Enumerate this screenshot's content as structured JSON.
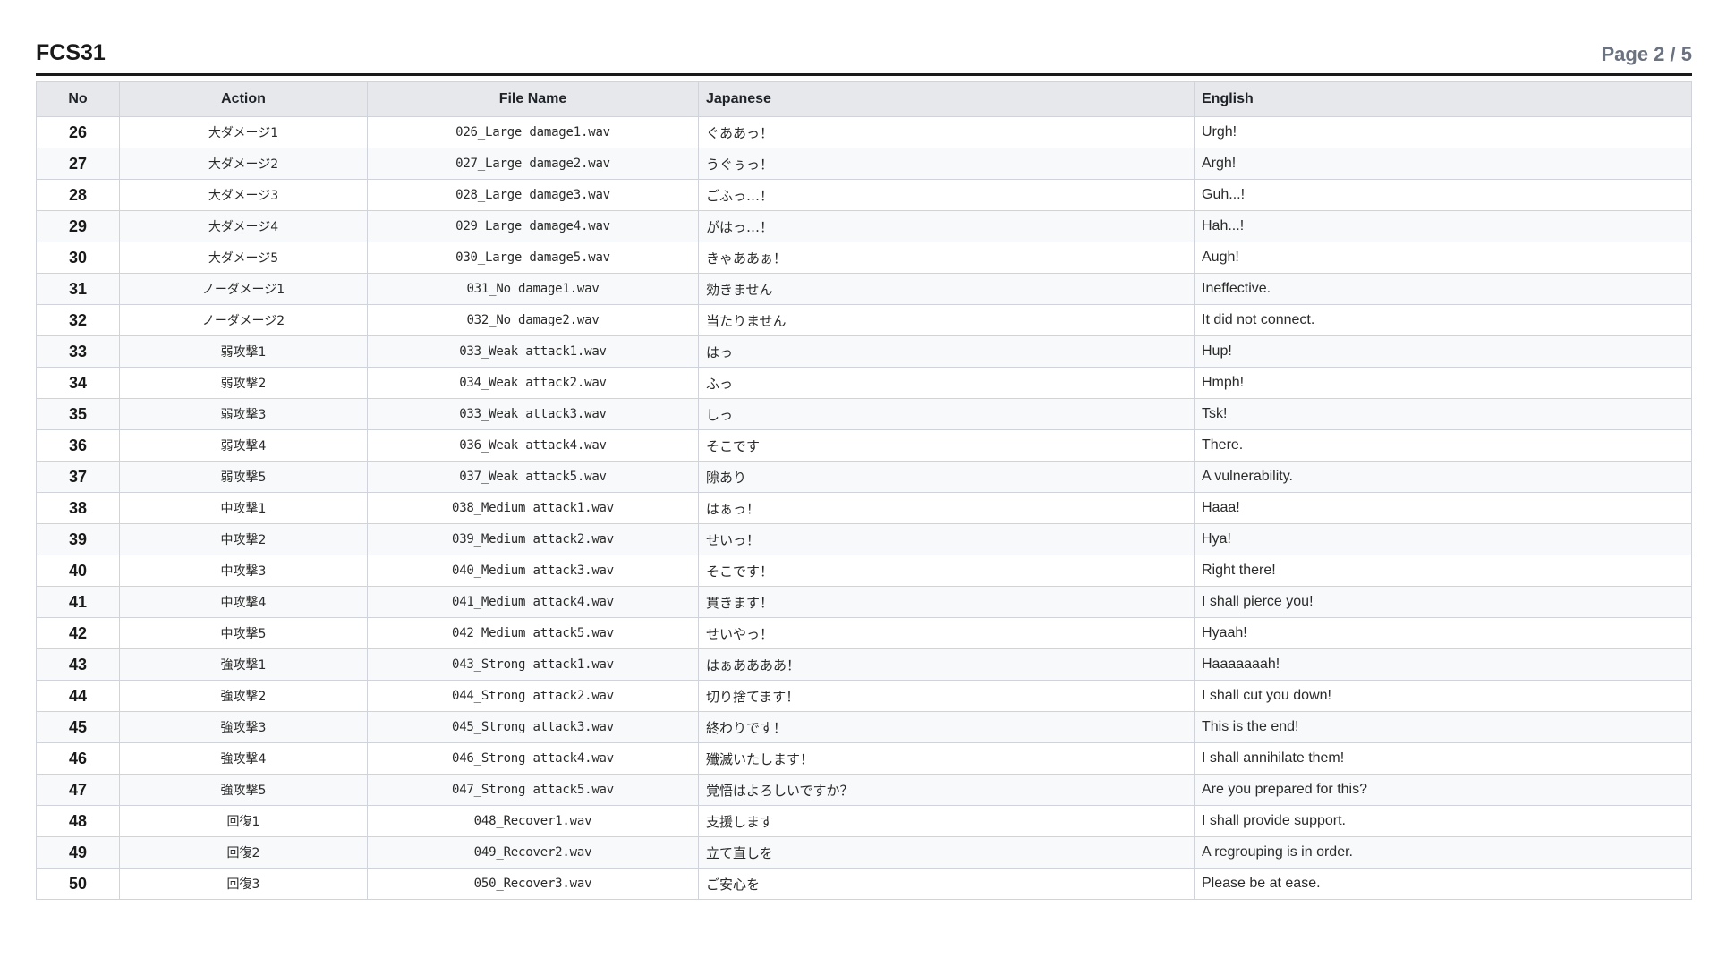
{
  "header": {
    "title": "FCS31",
    "page_indicator": "Page 2 / 5"
  },
  "table": {
    "columns": [
      "No",
      "Action",
      "File Name",
      "Japanese",
      "English"
    ],
    "rows": [
      {
        "no": "26",
        "action": "大ダメージ1",
        "file": "026_Large damage1.wav",
        "ja": "ぐああっ！",
        "en": "Urgh!"
      },
      {
        "no": "27",
        "action": "大ダメージ2",
        "file": "027_Large damage2.wav",
        "ja": "うぐぅっ！",
        "en": "Argh!"
      },
      {
        "no": "28",
        "action": "大ダメージ3",
        "file": "028_Large damage3.wav",
        "ja": "ごふっ…！",
        "en": "Guh...!"
      },
      {
        "no": "29",
        "action": "大ダメージ4",
        "file": "029_Large damage4.wav",
        "ja": "がはっ…！",
        "en": "Hah...!"
      },
      {
        "no": "30",
        "action": "大ダメージ5",
        "file": "030_Large damage5.wav",
        "ja": "きゃああぁ！",
        "en": "Augh!"
      },
      {
        "no": "31",
        "action": "ノーダメージ1",
        "file": "031_No damage1.wav",
        "ja": "効きません",
        "en": "Ineffective."
      },
      {
        "no": "32",
        "action": "ノーダメージ2",
        "file": "032_No damage2.wav",
        "ja": "当たりません",
        "en": "It did not connect."
      },
      {
        "no": "33",
        "action": "弱攻撃1",
        "file": "033_Weak attack1.wav",
        "ja": "はっ",
        "en": "Hup!"
      },
      {
        "no": "34",
        "action": "弱攻撃2",
        "file": "034_Weak attack2.wav",
        "ja": "ふっ",
        "en": "Hmph!"
      },
      {
        "no": "35",
        "action": "弱攻撃3",
        "file": "033_Weak attack3.wav",
        "ja": "しっ",
        "en": "Tsk!"
      },
      {
        "no": "36",
        "action": "弱攻撃4",
        "file": "036_Weak attack4.wav",
        "ja": "そこです",
        "en": "There."
      },
      {
        "no": "37",
        "action": "弱攻撃5",
        "file": "037_Weak attack5.wav",
        "ja": "隙あり",
        "en": "A vulnerability."
      },
      {
        "no": "38",
        "action": "中攻撃1",
        "file": "038_Medium attack1.wav",
        "ja": "はぁっ！",
        "en": "Haaa!"
      },
      {
        "no": "39",
        "action": "中攻撃2",
        "file": "039_Medium attack2.wav",
        "ja": "せいっ！",
        "en": "Hya!"
      },
      {
        "no": "40",
        "action": "中攻撃3",
        "file": "040_Medium attack3.wav",
        "ja": "そこです！",
        "en": "Right there!"
      },
      {
        "no": "41",
        "action": "中攻撃4",
        "file": "041_Medium attack4.wav",
        "ja": "貫きます！",
        "en": "I shall pierce you!"
      },
      {
        "no": "42",
        "action": "中攻撃5",
        "file": "042_Medium attack5.wav",
        "ja": "せいやっ！",
        "en": "Hyaah!"
      },
      {
        "no": "43",
        "action": "強攻撃1",
        "file": "043_Strong attack1.wav",
        "ja": "はぁああああ！",
        "en": "Haaaaaaah!"
      },
      {
        "no": "44",
        "action": "強攻撃2",
        "file": "044_Strong attack2.wav",
        "ja": "切り捨てます！",
        "en": "I shall cut you down!"
      },
      {
        "no": "45",
        "action": "強攻撃3",
        "file": "045_Strong attack3.wav",
        "ja": "終わりです！",
        "en": "This is the end!"
      },
      {
        "no": "46",
        "action": "強攻撃4",
        "file": "046_Strong attack4.wav",
        "ja": "殲滅いたします！",
        "en": "I shall annihilate them!"
      },
      {
        "no": "47",
        "action": "強攻撃5",
        "file": "047_Strong attack5.wav",
        "ja": "覚悟はよろしいですか？",
        "en": "Are you prepared for this?"
      },
      {
        "no": "48",
        "action": "回復1",
        "file": "048_Recover1.wav",
        "ja": "支援します",
        "en": "I shall provide support."
      },
      {
        "no": "49",
        "action": "回復2",
        "file": "049_Recover2.wav",
        "ja": "立て直しを",
        "en": "A regrouping is in order."
      },
      {
        "no": "50",
        "action": "回復3",
        "file": "050_Recover3.wav",
        "ja": "ご安心を",
        "en": "Please be at ease."
      }
    ]
  }
}
